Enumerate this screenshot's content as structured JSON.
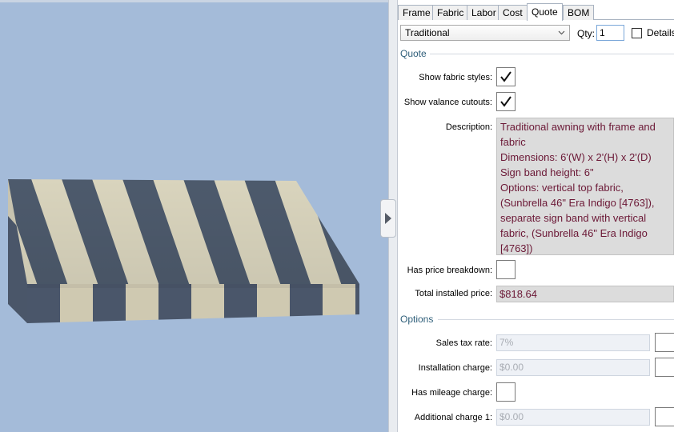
{
  "tabs": [
    "Frame",
    "Fabric",
    "Labor",
    "Cost",
    "Quote",
    "BOM"
  ],
  "active_tab": "Quote",
  "style_select": {
    "value": "Traditional"
  },
  "qty": {
    "label": "Qty:",
    "value": "1"
  },
  "details": {
    "label": "Details",
    "checked": false
  },
  "quote_section": {
    "title": "Quote",
    "show_fabric_styles": {
      "label": "Show fabric styles:",
      "checked": true
    },
    "show_valance_cutouts": {
      "label": "Show valance cutouts:",
      "checked": true
    },
    "description": {
      "label": "Description:",
      "lines": [
        "Traditional awning with frame and",
        "fabric",
        "Dimensions: 6'(W) x 2'(H) x 2'(D)",
        "Sign band height: 6\"",
        "Options: vertical top fabric,",
        "(Sunbrella 46\" Era Indigo [4763]),",
        "separate sign band with vertical",
        "fabric, (Sunbrella 46\" Era Indigo",
        "[4763])"
      ]
    },
    "has_price_breakdown": {
      "label": "Has price breakdown:",
      "checked": false
    },
    "total_installed_price": {
      "label": "Total installed price:",
      "value": "$818.64"
    }
  },
  "options_section": {
    "title": "Options",
    "sales_tax_rate": {
      "label": "Sales tax rate:",
      "value": "7%"
    },
    "installation_charge": {
      "label": "Installation charge:",
      "value": "$0.00"
    },
    "has_mileage_charge": {
      "label": "Has mileage charge:",
      "checked": false
    },
    "additional_charge_1": {
      "label": "Additional charge 1:",
      "value": "$0.00"
    }
  },
  "colors": {
    "viewport_bg": "#a4bbd9",
    "stripe_dark": "#4d5a6c",
    "stripe_light": "#d9d4bd",
    "field_text": "#6b1836",
    "section_text": "#2f5f7a"
  },
  "icons": {
    "collapse": "chevron-right-icon",
    "dropdown": "chevron-down-icon",
    "check": "checkmark-icon"
  }
}
